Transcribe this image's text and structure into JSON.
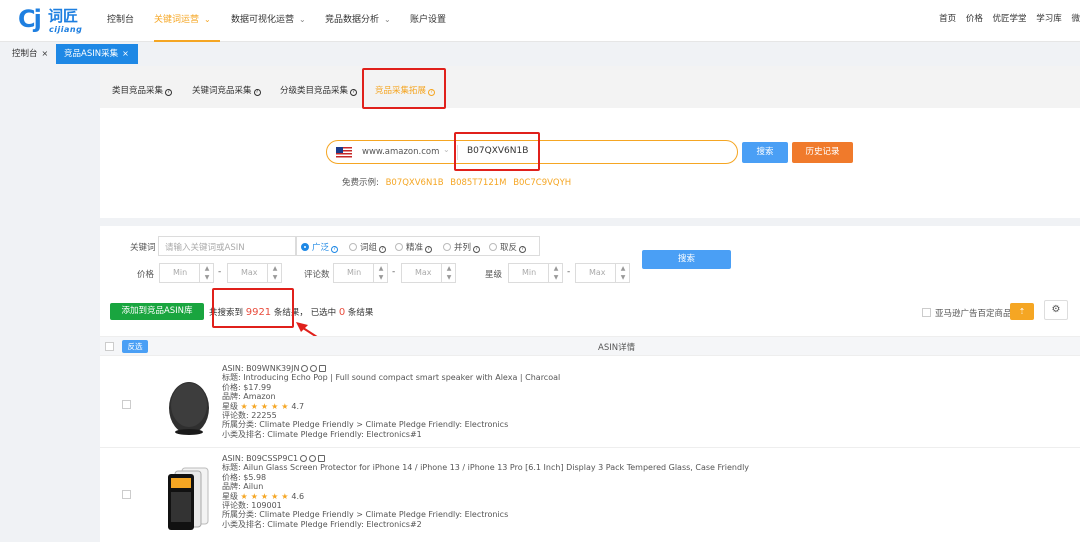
{
  "brand": {
    "cj": "Cj",
    "cn": "词匠",
    "en": "cijiang"
  },
  "nav": [
    {
      "label": "控制台"
    },
    {
      "label": "关键词运营"
    },
    {
      "label": "数据可视化运营"
    },
    {
      "label": "竞品数据分析"
    },
    {
      "label": "账户设置"
    }
  ],
  "top_right": [
    "首页",
    "价格",
    "优匠学堂",
    "学习库",
    "微"
  ],
  "tabs": {
    "home": "控制台",
    "current": "竞品ASIN采集"
  },
  "subtabs": [
    "类目竞品采集",
    "关键词竞品采集",
    "分级类目竞品采集",
    "竞品采集拓展"
  ],
  "search": {
    "site": "www.amazon.com",
    "asin": "B07QXV6N1B",
    "search_btn": "搜索",
    "history_btn": "历史记录",
    "examples_label": "免费示例:",
    "examples": [
      "B07QXV6N1B",
      "B085T7121M",
      "B0C7C9VQYH"
    ]
  },
  "filters": {
    "keyword_label": "关键词",
    "keyword_placeholder": "请输入关键词或ASIN",
    "match_modes": [
      "广泛",
      "词组",
      "精准",
      "并列",
      "取反"
    ],
    "price_label": "价格",
    "reviews_label": "评论数",
    "rating_label": "星级",
    "min": "Min",
    "max": "Max",
    "search_btn": "搜索"
  },
  "results": {
    "add_btn": "添加到竞品ASIN库",
    "found_prefix": "共搜索到",
    "found_count": "9921",
    "found_suffix": "条结果，",
    "selected_prefix": "已选中",
    "selected_count": "0",
    "selected_suffix": "条结果",
    "ad_filter": "亚马逊广告百定商品",
    "upload_icon": "upload-icon",
    "settings_icon": "settings-icon",
    "invert_btn": "反选",
    "column_title": "ASIN详情"
  },
  "products": [
    {
      "asin": "ASIN: B09WNK39JN",
      "title": "标题: Introducing Echo Pop | Full sound compact smart speaker with Alexa | Charcoal",
      "price": "价格: $17.99",
      "brand": "品牌: Amazon",
      "rating_label": "星级",
      "rating": "4.7",
      "reviews": "评论数: 22255",
      "category": "所属分类: Climate Pledge Friendly > Climate Pledge Friendly: Electronics",
      "rank": "小类及排名: Climate Pledge Friendly: Electronics#1"
    },
    {
      "asin": "ASIN: B09CSSP9C1",
      "title": "标题: Ailun Glass Screen Protector for iPhone 14 / iPhone 13 / iPhone 13 Pro [6.1 Inch] Display 3 Pack Tempered Glass, Case Friendly",
      "price": "价格: $5.98",
      "brand": "品牌: Ailun",
      "rating_label": "星级",
      "rating": "4.6",
      "reviews": "评论数: 109001",
      "category": "所属分类: Climate Pledge Friendly > Climate Pledge Friendly: Electronics",
      "rank": "小类及排名: Climate Pledge Friendly: Electronics#2"
    }
  ],
  "colors": {
    "accent_orange": "#f5a623",
    "primary_blue": "#1e88e5",
    "highlight_red": "#e0201b",
    "green": "#19a53f"
  }
}
